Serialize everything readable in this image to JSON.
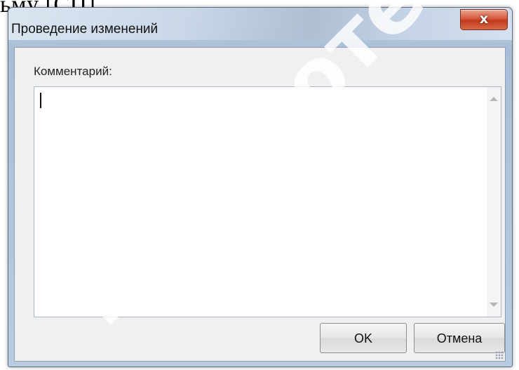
{
  "background_text": "ьму [СП].",
  "dialog": {
    "title": "Проведение изменений",
    "close_label": "x",
    "comment_label": "Комментарий:",
    "comment_value": "",
    "ok_label": "OK",
    "cancel_label": "Отмена"
  },
  "colors": {
    "close_button": "#d0503a",
    "window_frame": "#b5c8df",
    "client_background": "#f0f0f0"
  },
  "watermark": {
    "text": "Библиотека ГГТУ",
    "color": "#ffffff"
  },
  "icons": {
    "close": "close-icon",
    "scroll_up": "scroll-up-arrow-icon",
    "scroll_down": "scroll-down-arrow-icon",
    "resize_grip": "resize-grip-icon"
  }
}
